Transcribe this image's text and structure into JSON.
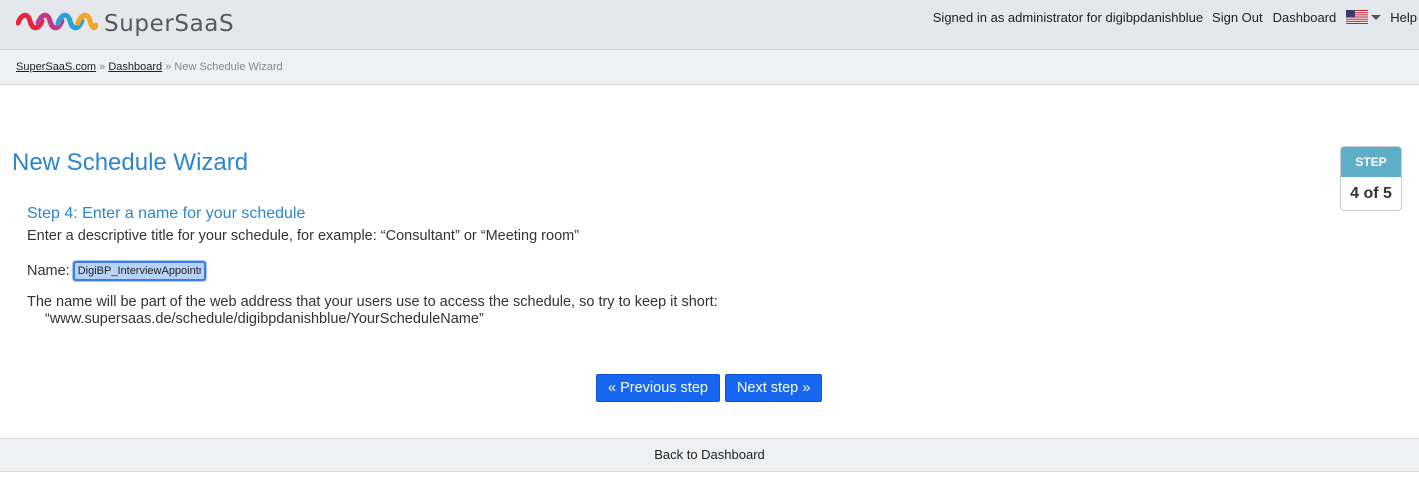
{
  "brand": {
    "name": "SuperSaaS"
  },
  "topnav": {
    "signed_in": "Signed in as administrator for digibpdanishblue",
    "sign_out": "Sign Out",
    "dashboard": "Dashboard",
    "help": "Help",
    "language_flag": "us-flag-icon"
  },
  "breadcrumb": {
    "home": "SuperSaaS.com",
    "sep1": " » ",
    "dashboard": "Dashboard",
    "sep2": " » ",
    "current": "New Schedule Wizard"
  },
  "page": {
    "title": "New Schedule Wizard"
  },
  "stepper": {
    "label": "STEP",
    "count": "4 of 5"
  },
  "step": {
    "heading": "Step 4: Enter a name for your schedule",
    "intro": "Enter a descriptive title for your schedule, for example: “Consultant” or “Meeting room”",
    "name_label": "Name:",
    "name_value": "DigiBP_InterviewAppointment",
    "note": "The name will be part of the web address that your users use to access the schedule, so try to keep it short:",
    "address": "“www.supersaas.de/schedule/digibpdanishblue/YourScheduleName”"
  },
  "buttons": {
    "previous": "« Previous step",
    "next": "Next step »"
  },
  "footer": {
    "back": "Back to Dashboard"
  },
  "colors": {
    "accent": "#2b86cc",
    "button": "#1666f0",
    "step_header": "#5eaec8"
  }
}
